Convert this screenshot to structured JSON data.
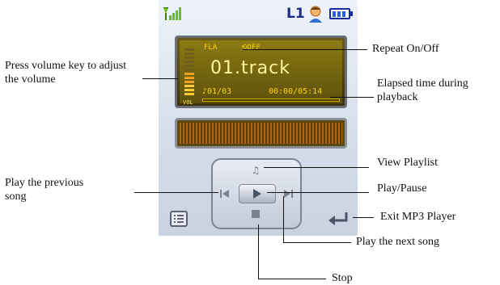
{
  "status": {
    "line_label": "L1"
  },
  "player": {
    "format": "FLA",
    "repeat": "OFF",
    "track": "01.track",
    "index": "01/03",
    "time": "00:00/05:14",
    "vol_label": "VOL"
  },
  "annotations": {
    "repeat": "Repeat On/Off",
    "volume": "Press volume key to adjust the volume",
    "elapsed": "Elapsed time during playback",
    "playlist": "View Playlist",
    "playpause": "Play/Pause",
    "previous": "Play the previous song",
    "exit": "Exit MP3 Player",
    "next": "Play the next song",
    "stop": "Stop"
  },
  "colors": {
    "lcd": "#8c7a12",
    "lcd_text": "#ffd400",
    "battery": "#2a5fe0",
    "signal": "#6bbf1f"
  }
}
